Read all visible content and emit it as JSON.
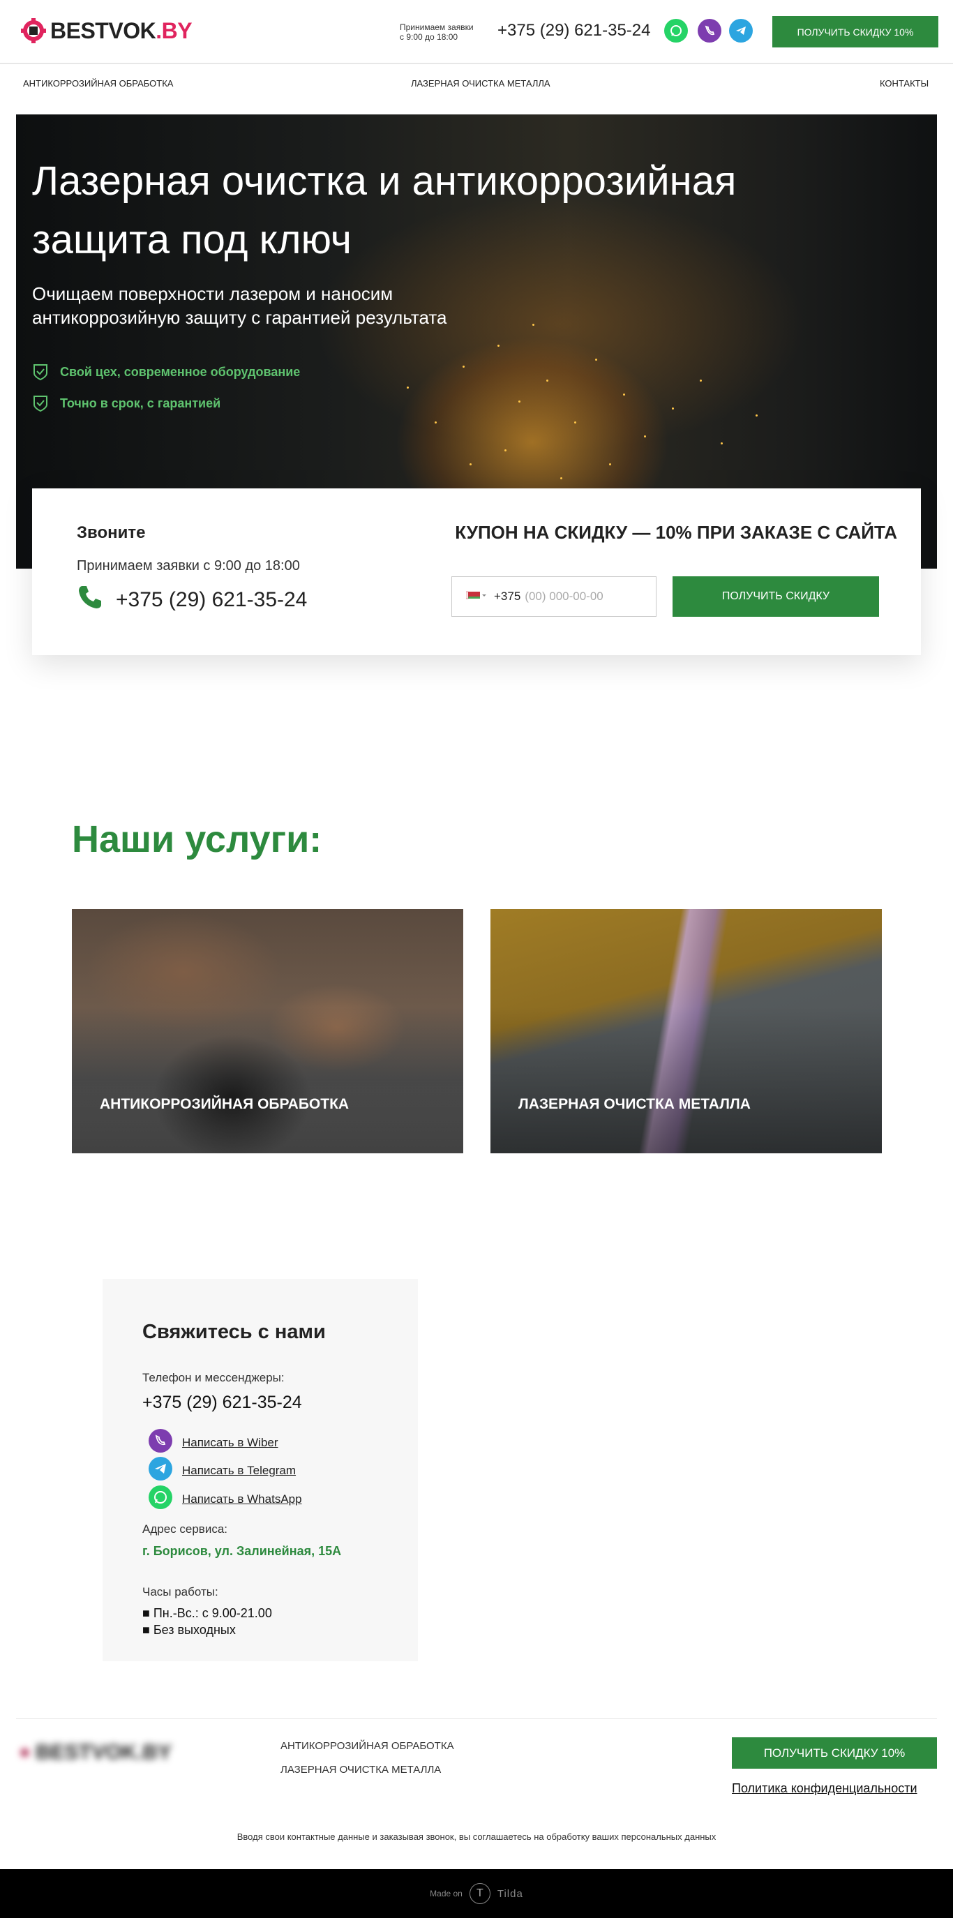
{
  "header": {
    "logo_prefix": "BESTVOK",
    "logo_suffix": ".BY",
    "hours_line1": "Принимаем заявки",
    "hours_line2": "с 9:00 до 18:00",
    "phone": "+375 (29) 621-35-24",
    "cta": "ПОЛУЧИТЬ СКИДКУ 10%",
    "messengers": [
      {
        "name": "whatsapp-icon",
        "color": "#25d366"
      },
      {
        "name": "viber-icon",
        "color": "#7d3daf"
      },
      {
        "name": "telegram-icon",
        "color": "#2ca5e0"
      }
    ]
  },
  "nav": {
    "items": [
      "АНТИКОРРОЗИЙНАЯ ОБРАБОТКА",
      "ЛАЗЕРНАЯ ОЧИСТКА МЕТАЛЛА",
      "КОНТАКТЫ"
    ]
  },
  "hero": {
    "title": "Лазерная очистка и антикоррозийная защита под ключ",
    "subtitle": "Очищаем поверхности лазером и наносим антикоррозийную защиту с гарантией результата",
    "features": [
      "Свой цех, современное оборудование",
      "Точно в срок, с гарантией"
    ]
  },
  "discount_card": {
    "call_title": "Звоните",
    "hours": "Принимаем заявки с 9:00 до 18:00",
    "phone": "+375 (29) 621-35-24",
    "coupon": "КУПОН НА СКИДКУ — 10% ПРИ ЗАКАЗЕ С САЙТА",
    "input_code": "+375",
    "input_placeholder": "(00) 000-00-00",
    "button": "ПОЛУЧИТЬ СКИДКУ"
  },
  "services": {
    "title": "Наши услуги:",
    "items": [
      "АНТИКОРРОЗИЙНАЯ ОБРАБОТКА",
      "ЛАЗЕРНАЯ ОЧИСТКА МЕТАЛЛА"
    ]
  },
  "contacts": {
    "title": "Свяжитесь с нами",
    "phone_label": "Телефон и мессенджеры:",
    "phone": "+375 (29) 621-35-24",
    "messengers": [
      "Написать в Wiber",
      "Написать в Telegram",
      "Написать в WhatsApp"
    ],
    "address_label": "Адрес сервиса:",
    "address": "г. Борисов, ул. Залинейная, 15А",
    "hours_label": "Часы работы:",
    "hours": [
      "■ Пн.-Вс.: с 9.00-21.00",
      "■ Без выходных"
    ]
  },
  "footer": {
    "logo_text": "BESTVOK.BY",
    "nav": [
      "АНТИКОРРОЗИЙНАЯ ОБРАБОТКА",
      "ЛАЗЕРНАЯ ОЧИСТКА МЕТАЛЛА"
    ],
    "cta": "ПОЛУЧИТЬ СКИДКУ 10%",
    "policy": "Политика конфиденциальности",
    "consent": "Вводя свои контактные данные и заказывая звонок, вы соглашаетесь на обработку ваших персональных данных",
    "made_on": "Made on",
    "tilda": "Tilda"
  },
  "colors": {
    "brand_green": "#2d8a3e",
    "feature_green": "#5fc36f",
    "logo_accent": "#e0245e"
  }
}
